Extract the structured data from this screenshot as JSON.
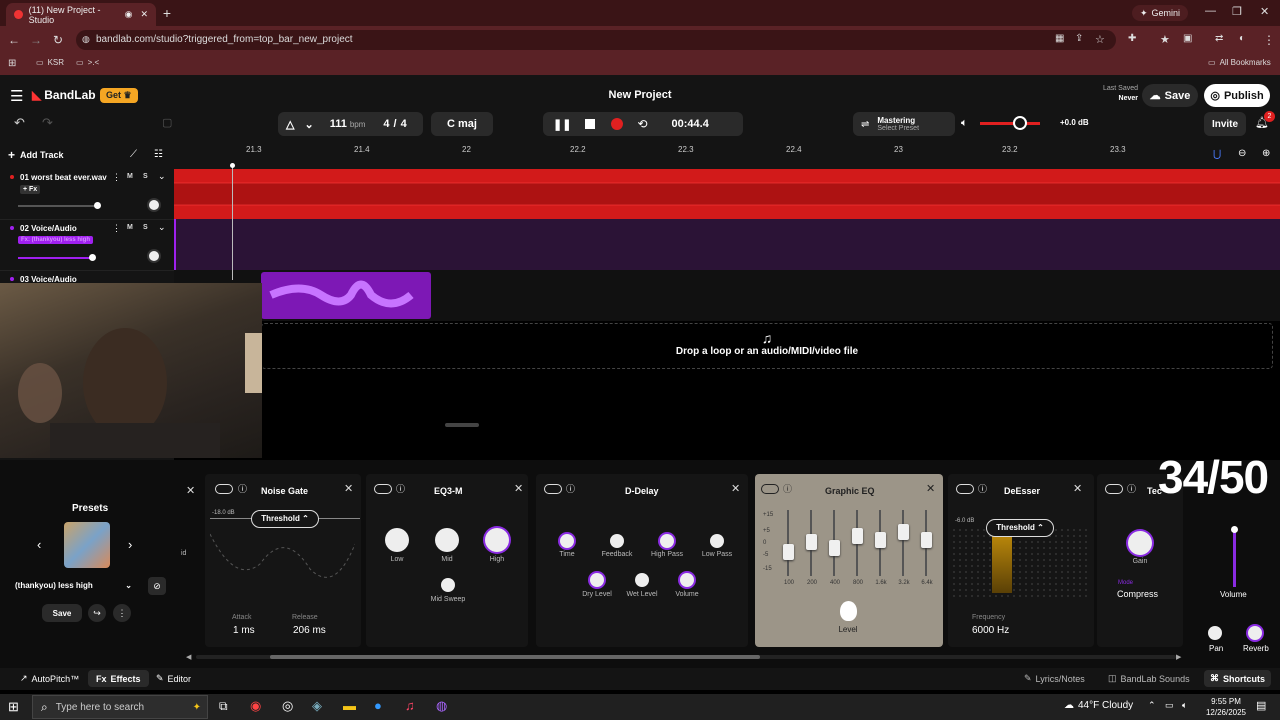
{
  "browser": {
    "tab_title": "(11) New Project - Studio",
    "gemini": "Gemini",
    "url": "bandlab.com/studio?triggered_from=top_bar_new_project",
    "bookmarks": [
      "KSR",
      ">.<"
    ],
    "all_bookmarks": "All Bookmarks"
  },
  "app": {
    "logo": "BandLab",
    "get": "Get",
    "title": "New Project",
    "last_saved_label": "Last Saved",
    "last_saved_value": "Never",
    "save": "Save",
    "publish": "Publish",
    "invite": "Invite",
    "notif_count": "2",
    "tempo": "111",
    "bpm": "bpm",
    "time_sig_num": "4",
    "time_sig_den": "4",
    "key": "C maj",
    "time": "00:44.4",
    "mastering": "Mastering",
    "select_preset": "Select Preset",
    "master_db": "+0.0 dB"
  },
  "tracks_ui": {
    "add_track": "Add Track",
    "ruler": [
      "21.3",
      "21.4",
      "22",
      "22.2",
      "22.3",
      "22.4",
      "23",
      "23.2",
      "23.3"
    ],
    "tracks": [
      {
        "num": "01",
        "name": "worst beat ever.wav",
        "fx": "+ Fx"
      },
      {
        "num": "02",
        "name": "Voice/Audio",
        "fx": "Fx: (thankyou) less high"
      },
      {
        "num": "03",
        "name": "Voice/Audio"
      }
    ],
    "mute": "M",
    "solo": "S",
    "drop": "Drop a loop or an audio/MIDI/video file"
  },
  "presets": {
    "title": "Presets",
    "selected": "(thankyou) less high",
    "save": "Save"
  },
  "effects": {
    "id": "id",
    "noise_gate": {
      "title": "Noise Gate",
      "db": "-18.0 dB",
      "mode": "Threshold",
      "attack_label": "Attack",
      "attack": "1 ms",
      "release_label": "Release",
      "release": "206 ms"
    },
    "eq3": {
      "title": "EQ3-M",
      "low": "Low",
      "mid": "Mid",
      "high": "High",
      "mid_sweep": "Mid Sweep"
    },
    "delay": {
      "title": "D-Delay",
      "time": "Time",
      "feedback": "Feedback",
      "high_pass": "High Pass",
      "low_pass": "Low Pass",
      "dry": "Dry Level",
      "wet": "Wet Level",
      "volume": "Volume"
    },
    "geq": {
      "title": "Graphic EQ",
      "scale": [
        "+15",
        "+5",
        "0",
        "-5",
        "-15"
      ],
      "bands": [
        "100",
        "200",
        "400",
        "800",
        "1.6k",
        "3.2k",
        "6.4k"
      ],
      "level": "Level"
    },
    "deesser": {
      "title": "DeEsser",
      "db": "-6.0 dB",
      "mode": "Threshold",
      "freq_label": "Frequency",
      "freq": "6000 Hz"
    },
    "tech": {
      "title": "Tec",
      "gain": "Gain",
      "mode_label": "Mode",
      "mode": "Compress"
    },
    "counter": "34/50",
    "volume": "Volume",
    "pan": "Pan",
    "reverb": "Reverb"
  },
  "bottom": {
    "autopitch": "AutoPitch™",
    "effects": "Effects",
    "editor": "Editor",
    "lyrics": "Lyrics/Notes",
    "sounds": "BandLab Sounds",
    "shortcuts": "Shortcuts"
  },
  "taskbar": {
    "search": "Type here to search",
    "weather": "44°F Cloudy",
    "time": "9:55 PM",
    "date": "12/26/2025"
  }
}
